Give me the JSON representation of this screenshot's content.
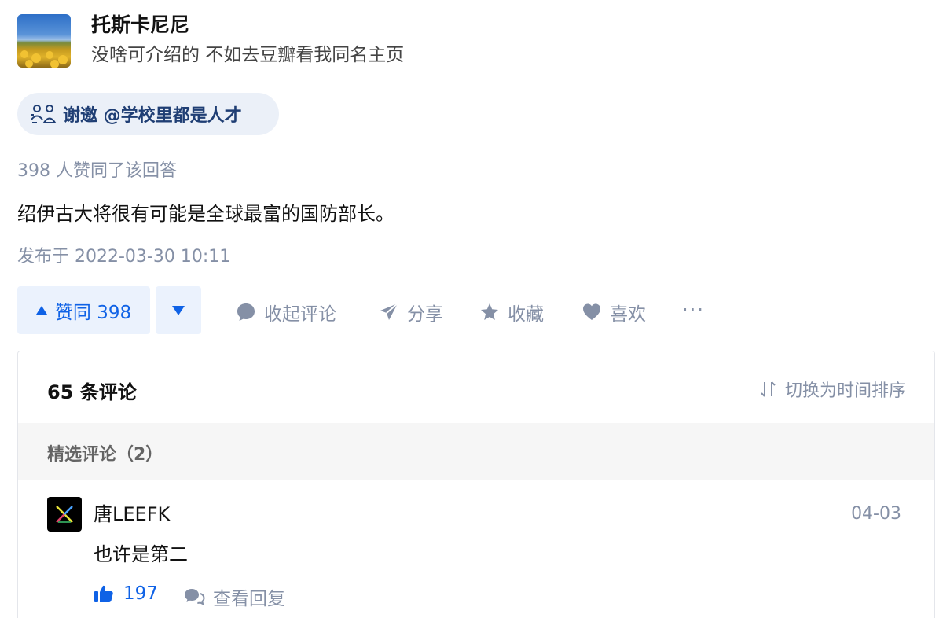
{
  "author": {
    "name": "托斯卡尼尼",
    "bio": "没啥可介绍的 不如去豆瓣看我同名主页"
  },
  "invite": {
    "text": "谢邀 @学校里都是人才"
  },
  "answer": {
    "upvote_summary": "398 人赞同了该回答",
    "content": "绍伊古大将很有可能是全球最富的国防部长。",
    "published": "发布于 2022-03-30 10:11"
  },
  "actions": {
    "upvote_label": "赞同 398",
    "collapse_comments": "收起评论",
    "share": "分享",
    "favorite": "收藏",
    "like": "喜欢",
    "more": "···"
  },
  "comments": {
    "count_label": "65 条评论",
    "sort_label": "切换为时间排序",
    "featured_label": "精选评论（2）",
    "items": [
      {
        "user": "唐LEEFK",
        "date": "04-03",
        "text": "也许是第二",
        "likes": "197",
        "view_replies": "查看回复"
      }
    ]
  },
  "colors": {
    "accent": "#0f62e6",
    "muted": "#8590a6",
    "invite_bg": "#ebf0f8",
    "invite_text": "#1f3e74"
  }
}
